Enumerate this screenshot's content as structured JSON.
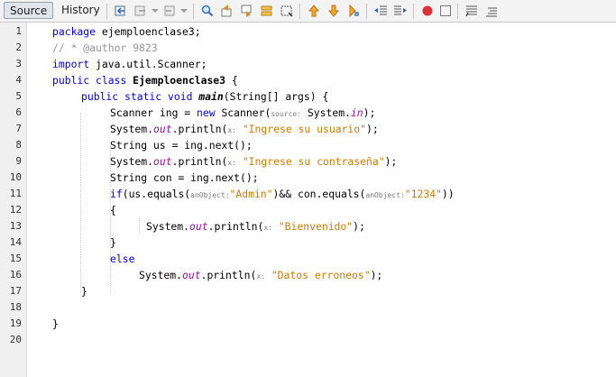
{
  "tabs": {
    "source": "Source",
    "history": "History"
  },
  "toolbar_icons": [
    "last-edit-icon",
    "back-icon",
    "forward-icon",
    "find-icon",
    "find-previous-icon",
    "find-next-icon",
    "find-selection-icon",
    "toggle-highlight-icon",
    "previous-bookmark-icon",
    "next-bookmark-icon",
    "toggle-bookmark-icon",
    "shift-left-icon",
    "shift-right-icon",
    "start-macro-icon",
    "stop-macro-icon",
    "comment-icon",
    "uncomment-icon"
  ],
  "line_numbers": [
    "1",
    "2",
    "3",
    "4",
    "5",
    "6",
    "7",
    "8",
    "9",
    "10",
    "11",
    "12",
    "13",
    "14",
    "15",
    "16",
    "17",
    "18",
    "19",
    "20"
  ],
  "code": {
    "l1": {
      "kw": "package",
      "rest": " ejemploenclase3;"
    },
    "l2": {
      "comment": "// * @author 9823"
    },
    "l3": {
      "kw": "import",
      "rest": " java.util.Scanner;"
    },
    "l4": {
      "kw": "public class",
      "cls": " Ejemploenclase3",
      "rest": " {"
    },
    "l5": {
      "kw": "public static void",
      "name": " main",
      "rest": "(String[] args) {"
    },
    "l6": {
      "a": "Scanner ing = ",
      "kw": "new",
      "b": " Scanner(",
      "hint": "source:",
      "c": " System.",
      "fld": "in",
      "d": ");"
    },
    "l7": {
      "a": "System.",
      "fld": "out",
      "b": ".println(",
      "hint": "x:",
      "str": " \"Ingrese su usuario\"",
      "d": ");"
    },
    "l8": {
      "a": "String us = ing.next();"
    },
    "l9": {
      "a": "System.",
      "fld": "out",
      "b": ".println(",
      "hint": "x:",
      "str": " \"Ingrese su contraseña\"",
      "d": ");"
    },
    "l10": {
      "a": "String con = ing.next();"
    },
    "l11": {
      "kw": "if",
      "a": "(us.equals(",
      "hint1": "anObject:",
      "str1": "\"Admin\"",
      "b": ")&& con.equals(",
      "hint2": "anObject:",
      "str2": "\"1234\"",
      "c": "))"
    },
    "l12": {
      "a": "{"
    },
    "l13": {
      "a": "System.",
      "fld": "out",
      "b": ".println(",
      "hint": "x:",
      "str": " \"Bienvenido\"",
      "d": ");"
    },
    "l14": {
      "a": "}"
    },
    "l15": {
      "kw": "else"
    },
    "l16": {
      "a": "System.",
      "fld": "out",
      "b": ".println(",
      "hint": "x:",
      "str": " \"Datos erroneos\"",
      "d": ");"
    },
    "l17": {
      "a": "}"
    },
    "l19": {
      "a": "}"
    }
  }
}
